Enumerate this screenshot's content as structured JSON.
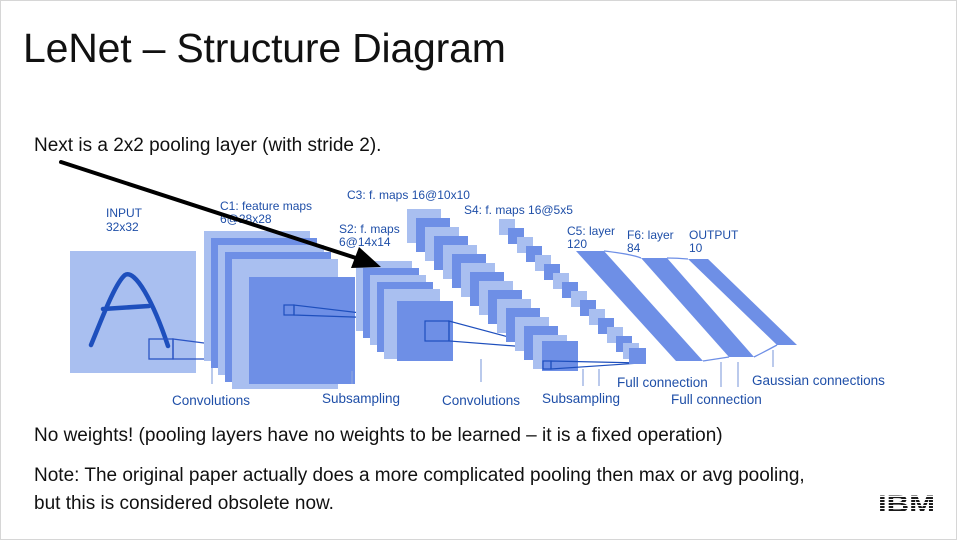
{
  "slide": {
    "title": "LeNet – Structure Diagram",
    "caption": "Next is a 2x2 pooling layer (with stride 2).",
    "note_weights": "No weights! (pooling layers have no weights to be learned – it is a fixed operation)",
    "note_paper_line1": "Note: The original paper actually does a more complicated pooling then max or avg pooling,",
    "note_paper_line2": "but this is considered obsolete now.",
    "logo_text": "IBM"
  },
  "diagram": {
    "input_label_1": "INPUT",
    "input_label_2": "32x32",
    "c1_label_1": "C1: feature maps",
    "c1_label_2": "6@28x28",
    "s2_label_1": "S2: f. maps",
    "s2_label_2": "6@14x14",
    "c3_label": "C3: f. maps 16@10x10",
    "s4_label": "S4: f. maps 16@5x5",
    "c5_label_1": "C5: layer",
    "c5_label_2": "120",
    "f6_label_1": "F6: layer",
    "f6_label_2": "84",
    "output_label_1": "OUTPUT",
    "output_label_2": "10",
    "bottom_convolutions_1": "Convolutions",
    "bottom_subsampling_1": "Subsampling",
    "bottom_convolutions_2": "Convolutions",
    "bottom_subsampling_2": "Subsampling",
    "bottom_full_connection_1": "Full connection",
    "bottom_full_connection_2": "Full connection",
    "bottom_gaussian": "Gaussian connections",
    "colors": {
      "dark": "#6e8fe6",
      "light": "#a9bff0",
      "text": "#1f4fa8",
      "arrow": "#000000"
    }
  }
}
